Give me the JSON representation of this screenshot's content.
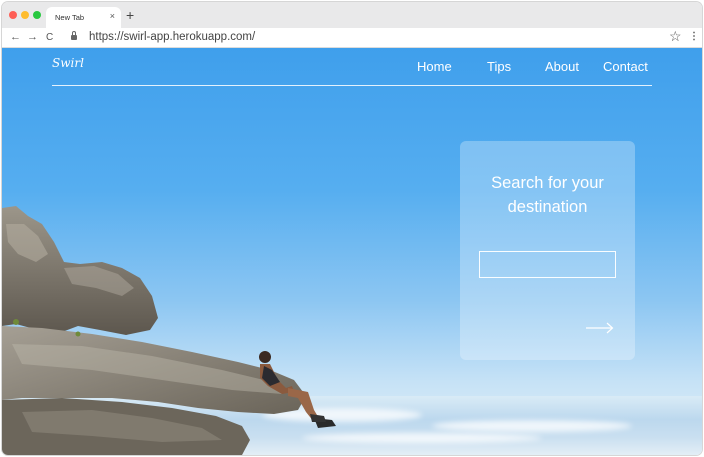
{
  "browser": {
    "tab_title": "New Tab",
    "tab_close_glyph": "×",
    "new_tab_glyph": "+",
    "back_glyph": "←",
    "forward_glyph": "→",
    "reload_glyph": "C",
    "url": "https://swirl-app.herokuapp.com/",
    "bookmark_glyph": "☆",
    "menu_glyph": "⋮",
    "icons": [
      "back-arrow-icon",
      "forward-arrow-icon",
      "reload-icon",
      "lock-icon",
      "star-icon",
      "menu-icon"
    ]
  },
  "site": {
    "logo": "Swirl",
    "nav": [
      {
        "label": "Home"
      },
      {
        "label": "Tips"
      },
      {
        "label": "About"
      },
      {
        "label": "Contact"
      }
    ]
  },
  "search": {
    "heading": "Search for your destination",
    "input_value": "",
    "placeholder": "",
    "submit_icon": "right-arrow-icon"
  },
  "colors": {
    "sky_top": "#3f9fec",
    "sky_bottom": "#e6f1f8",
    "rock": "#8a8479",
    "card_overlay": "rgba(255,255,255,0.28)",
    "traffic_red": "#fe5f57",
    "traffic_yellow": "#febc2e",
    "traffic_green": "#28c840"
  }
}
